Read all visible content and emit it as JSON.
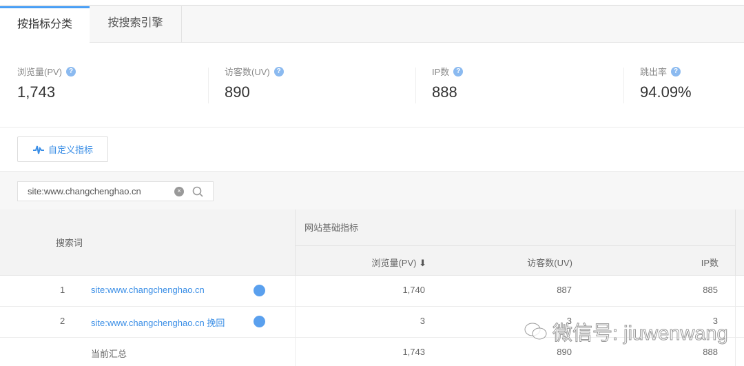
{
  "tabs": [
    {
      "label": "按指标分类",
      "active": true
    },
    {
      "label": "按搜索引擎",
      "active": false
    }
  ],
  "metrics": [
    {
      "label": "浏览量(PV)",
      "value": "1,743"
    },
    {
      "label": "访客数(UV)",
      "value": "890"
    },
    {
      "label": "IP数",
      "value": "888"
    },
    {
      "label": "跳出率",
      "value": "94.09%"
    }
  ],
  "custom_metric_button": "自定义指标",
  "search": {
    "value": "site:www.changchenghao.cn"
  },
  "table": {
    "keyword_header": "搜索词",
    "group_header": "网站基础指标",
    "columns": [
      "浏览量(PV)",
      "访客数(UV)",
      "IP数"
    ],
    "rows": [
      {
        "index": "1",
        "keyword": "site:www.changchenghao.cn",
        "pv": "1,740",
        "uv": "887",
        "ip": "885"
      },
      {
        "index": "2",
        "keyword": "site:www.changchenghao.cn 挽回",
        "pv": "3",
        "uv": "3",
        "ip": "3"
      }
    ],
    "total": {
      "label": "当前汇总",
      "pv": "1,743",
      "uv": "890",
      "ip": "888"
    }
  },
  "colors": {
    "accent": "#4a9ff5",
    "link": "#3a8ee6"
  },
  "watermark": "微信号: jiuwenwang"
}
